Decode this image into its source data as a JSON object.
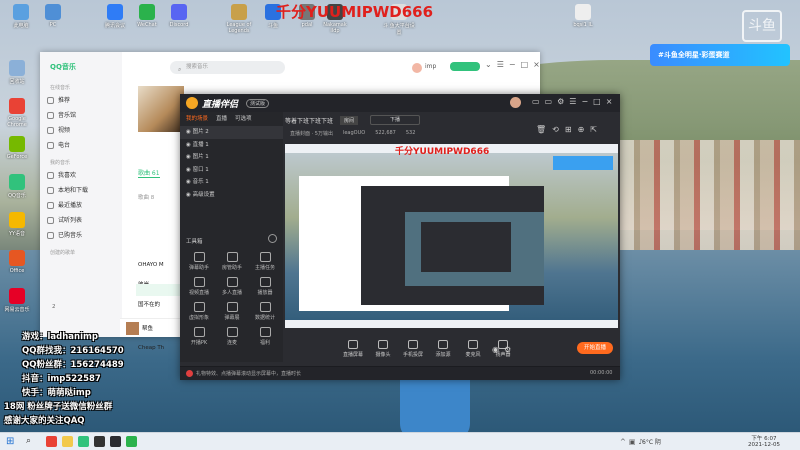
{
  "watermark": "千分YUUMIPWD666",
  "preview_watermark": "千分YUUMIPWD666",
  "desktop_icons": [
    {
      "label": "此电脑",
      "color": "#5aa0e0"
    },
    {
      "label": "PC",
      "color": "#4f8fd6"
    },
    {
      "label": "腾讯会议",
      "color": "#2f7cf6"
    },
    {
      "label": "WeChat",
      "color": "#2bb24c"
    },
    {
      "label": "Discord",
      "color": "#5865f2"
    },
    {
      "label": "League of Legends",
      "color": "#c8a04a"
    },
    {
      "label": "斗鱼",
      "color": "#2b71e0"
    },
    {
      "label": "pdal",
      "color": "#777"
    },
    {
      "label": "Nakamak ildp",
      "color": "#444"
    },
    {
      "label": "斗 鱼大平台设置",
      "color": "#ddd"
    },
    {
      "label": "bqsi1 IL",
      "color": "#eee"
    }
  ],
  "left_icons": [
    {
      "label": "回收站",
      "color": "#8bb0d8"
    },
    {
      "label": "Google Chrome",
      "color": "#e94235"
    },
    {
      "label": "GeForce",
      "color": "#76b900"
    },
    {
      "label": "QQ音乐",
      "color": "#31c27c"
    },
    {
      "label": "YY语音",
      "color": "#f5b800"
    },
    {
      "label": "Office",
      "color": "#e65722"
    },
    {
      "label": "网易云音乐",
      "color": "#e60026"
    }
  ],
  "douyu_logo": "斗鱼",
  "banner": "#斗鱼全明星·彩蛋赛道",
  "qqmusic": {
    "logo": "QQ音乐",
    "search_placeholder": "搜索音乐",
    "user": "imp",
    "nav_sections": [
      {
        "title": "在线音乐",
        "items": [
          "推荐",
          "音乐馆",
          "视频",
          "电台"
        ]
      },
      {
        "title": "我的音乐",
        "items": [
          "我喜欢",
          "本地和下载",
          "最近播放",
          "试听列表",
          "已购音乐"
        ]
      },
      {
        "title": "创建的歌单",
        "items": []
      }
    ],
    "list_tabs": [
      "歌曲 61"
    ],
    "songs": [
      "OHAYO M",
      "彼岸",
      "国不在的",
      "Cheap Th"
    ],
    "song_header": "歌曲 8",
    "playlist_count": "2",
    "now_playing": "帮鱼"
  },
  "live": {
    "title": "直播伴侣",
    "version": "测试版",
    "tabs": [
      "我的场景",
      "直播",
      "可选项"
    ],
    "scenes": [
      "图片 2",
      "直播 1",
      "图片 1",
      "窗口 1",
      "音乐 1",
      "高级设置"
    ],
    "tools_title": "工具箱",
    "tools": [
      "弹幕助手",
      "房管助手",
      "主播任务",
      "视频直播",
      "多人直播",
      "播放器",
      "虚拟形象",
      "弹幕展",
      "数据统计",
      "开播PK",
      "连麦",
      "福利"
    ],
    "top_room": "等着下班下班下班",
    "top_chip": "房间",
    "top_right": "下播",
    "stats": [
      "直播封面 · 5万输出",
      "leagOUO",
      "522,687",
      "532"
    ],
    "bottom_buttons": [
      "直播屏幕",
      "摄像头",
      "手机投屏",
      "添加源",
      "麦克风",
      "扬声器"
    ],
    "start_button": "开始直播",
    "status": "礼物特效、点播弹幕滚动显示屏幕中，直播时长",
    "timer": "00:00:00"
  },
  "overlay_lines": [
    "游戏：ladhanimp",
    "QQ群找我：216164570",
    "QQ粉丝群：156274489",
    "抖音：imp522587",
    "快手：萌萌哒imp",
    "18网 粉丝牌子送微信粉丝群",
    "感谢大家的关注QAQ"
  ],
  "taskbar": {
    "weather": "6°C 阴",
    "time": "下午 6:07",
    "date": "2021-12-05"
  }
}
